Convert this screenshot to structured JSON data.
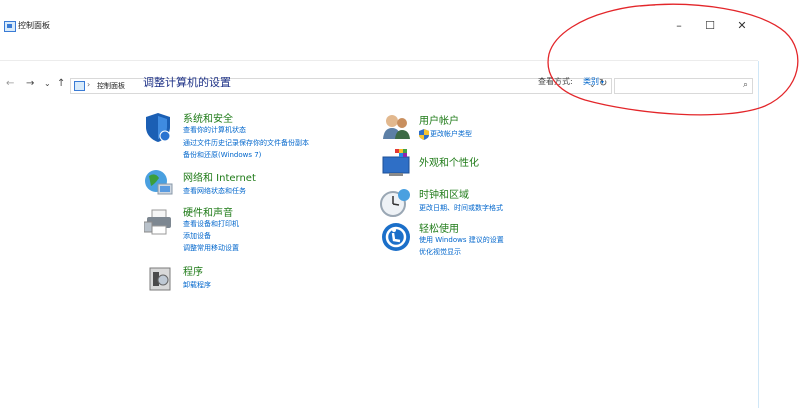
{
  "window": {
    "title": "控制面板",
    "controls": {
      "minimize": "–",
      "maximize": "☐",
      "close": "✕"
    }
  },
  "addressbar": {
    "back": "←",
    "forward": "→",
    "recent": "⌄",
    "up": "↑",
    "breadcrumb": "控制面板",
    "separator": "›",
    "dropdown": "⌄",
    "refresh": "↻",
    "search_placeholder": "",
    "search_icon": "⌕"
  },
  "main": {
    "heading": "调整计算机的设置",
    "view_by_label": "查看方式:",
    "view_by_value": "类别"
  },
  "categories": [
    {
      "title": "系统和安全",
      "links": [
        "查看你的计算机状态",
        "通过文件历史记录保存你的文件备份副本",
        "备份和还原(Windows 7)"
      ]
    },
    {
      "title": "网络和 Internet",
      "links": [
        "查看网络状态和任务"
      ]
    },
    {
      "title": "硬件和声音",
      "links": [
        "查看设备和打印机",
        "添加设备",
        "调整常用移动设置"
      ]
    },
    {
      "title": "程序",
      "links": [
        "卸载程序"
      ]
    },
    {
      "title": "用户帐户",
      "links": [
        "更改帐户类型"
      ]
    },
    {
      "title": "外观和个性化",
      "links": []
    },
    {
      "title": "时钟和区域",
      "links": [
        "更改日期、时间或数字格式"
      ]
    },
    {
      "title": "轻松使用",
      "links": [
        "使用 Windows 建议的设置",
        "优化视觉显示"
      ]
    }
  ],
  "icons": [
    "control-panel-icon",
    "shield-icon",
    "globe-icon",
    "printer-icon",
    "programs-icon",
    "users-icon",
    "monitor-palette-icon",
    "clock-icon",
    "accessibility-icon",
    "uac-shield-icon"
  ],
  "colors": {
    "category_title": "#1f7b18",
    "link": "#0066cc",
    "heading": "#1e3287",
    "annotation": "#e3262a"
  }
}
